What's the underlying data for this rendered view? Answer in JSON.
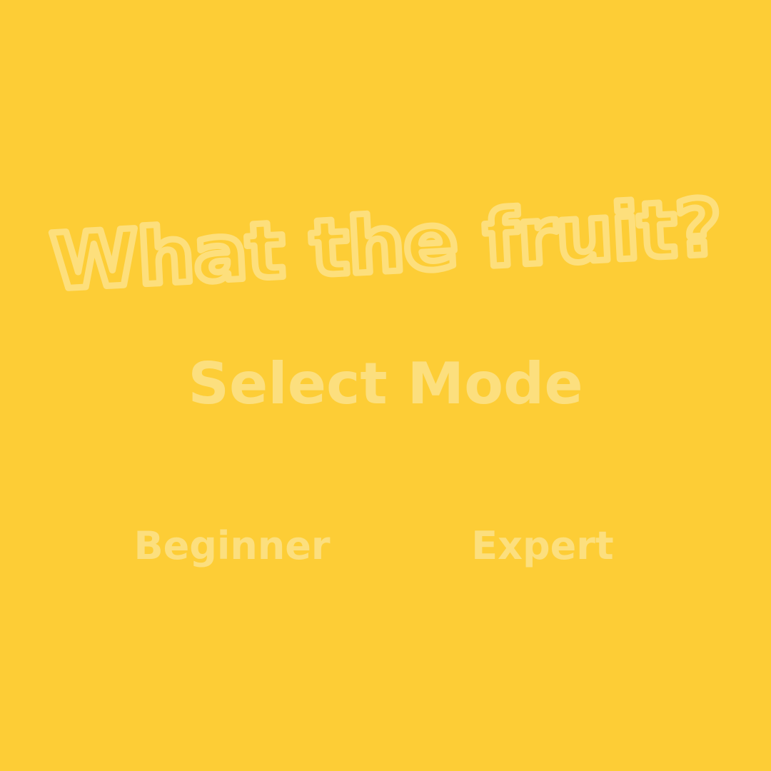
{
  "game": {
    "title": "What the fruit?",
    "subtitle": "Select Mode",
    "modes": [
      {
        "label": "Beginner"
      },
      {
        "label": "Expert"
      }
    ]
  },
  "colors": {
    "background": "#FDCD36",
    "faded_text": "#FCDF7E",
    "title_outline": "#FDDF7C"
  }
}
